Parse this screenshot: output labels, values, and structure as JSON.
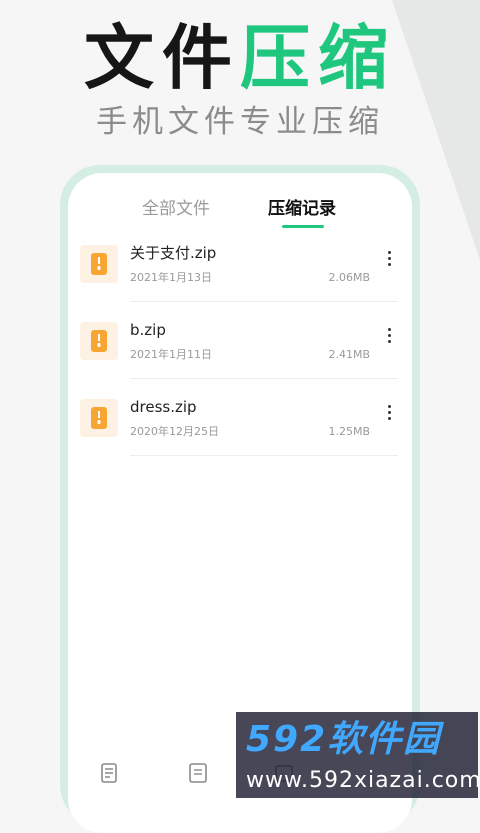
{
  "header": {
    "title_dark": "文件",
    "title_green": "压缩",
    "subtitle": "手机文件专业压缩"
  },
  "tabs": [
    {
      "label": "全部文件",
      "active": false
    },
    {
      "label": "压缩记录",
      "active": true
    }
  ],
  "files": [
    {
      "name": "关于支付.zip",
      "date": "2021年1月13日",
      "size": "2.06MB",
      "icon": "zip-file-icon"
    },
    {
      "name": "b.zip",
      "date": "2021年1月11日",
      "size": "2.41MB",
      "icon": "zip-file-icon"
    },
    {
      "name": "dress.zip",
      "date": "2020年12月25日",
      "size": "1.25MB",
      "icon": "zip-file-icon"
    }
  ],
  "bottom_nav": [
    "document-icon",
    "list-icon",
    "folder-icon"
  ],
  "watermark": {
    "logo": "592软件园",
    "url": "www.592xiazai.com"
  },
  "colors": {
    "accent": "#1fc77e",
    "file_icon": "#f7a634",
    "phone_frame": "#d4eee4"
  }
}
